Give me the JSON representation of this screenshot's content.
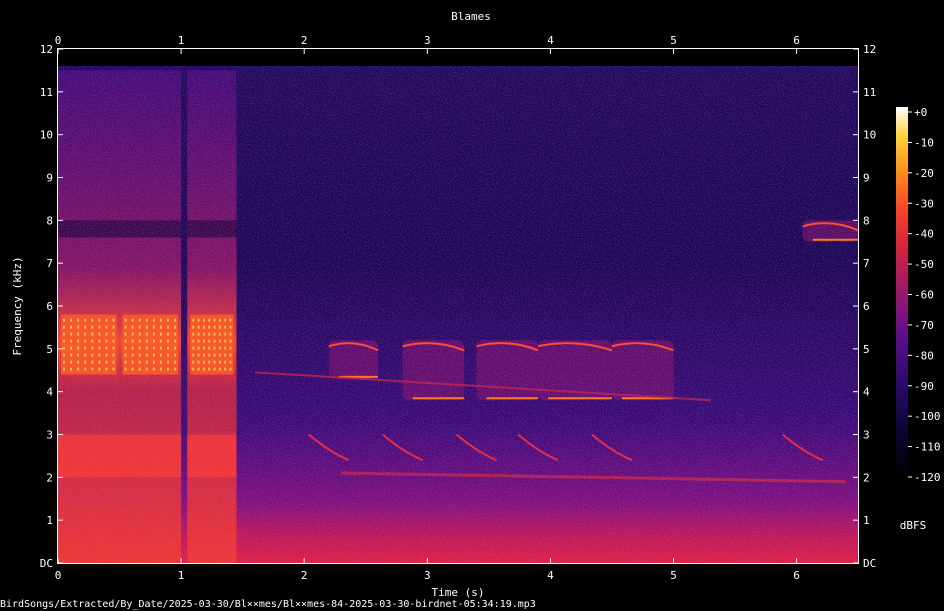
{
  "chart_data": {
    "type": "heatmap",
    "title": "Blames",
    "xlabel": "Time (s)",
    "ylabel": "Frequency (kHz)",
    "xlim": [
      0,
      6.5
    ],
    "ylim": [
      0,
      12
    ],
    "x_ticks": [
      "0",
      "1",
      "2",
      "3",
      "4",
      "5",
      "6"
    ],
    "y_ticks": [
      "DC",
      "1",
      "2",
      "3",
      "4",
      "5",
      "6",
      "7",
      "8",
      "9",
      "10",
      "11",
      "12"
    ],
    "colorbar": {
      "label": "dBFS",
      "range": [
        -120,
        0
      ],
      "ticks": [
        "+0",
        "-10",
        "-20",
        "-30",
        "-40",
        "-50",
        "-60",
        "-70",
        "-80",
        "-90",
        "-100",
        "-110",
        "-120"
      ]
    },
    "features": [
      {
        "kind": "broadband-burst",
        "t": [
          0.0,
          0.5
        ],
        "f": [
          0,
          11.5
        ],
        "level": "high"
      },
      {
        "kind": "broadband-burst",
        "t": [
          0.5,
          1.0
        ],
        "f": [
          0,
          11.5
        ],
        "level": "high"
      },
      {
        "kind": "broadband-burst",
        "t": [
          1.05,
          1.45
        ],
        "f": [
          0,
          11.5
        ],
        "level": "high"
      },
      {
        "kind": "tonal-note",
        "t": [
          2.2,
          2.6
        ],
        "f": [
          4.3,
          5.2
        ]
      },
      {
        "kind": "tonal-note",
        "t": [
          2.8,
          3.3
        ],
        "f": [
          3.8,
          5.2
        ]
      },
      {
        "kind": "tonal-note",
        "t": [
          3.4,
          3.9
        ],
        "f": [
          3.8,
          5.2
        ]
      },
      {
        "kind": "tonal-note",
        "t": [
          3.9,
          4.5
        ],
        "f": [
          3.8,
          5.2
        ]
      },
      {
        "kind": "tonal-note",
        "t": [
          4.5,
          5.0
        ],
        "f": [
          3.8,
          5.2
        ]
      },
      {
        "kind": "tonal-note",
        "t": [
          6.05,
          6.5
        ],
        "f": [
          7.5,
          8.0
        ]
      }
    ]
  },
  "footer": {
    "path": "BirdSongs/Extracted/By_Date/2025-03-30/Bl××mes/Bl××mes-84-2025-03-30-birdnet-05:34:19.mp3"
  },
  "colors": {
    "background": "#000000",
    "text": "#ffffff",
    "colormap": [
      "#000000",
      "#0b0530",
      "#2a0a6a",
      "#5a0e8a",
      "#9a1a6c",
      "#d4233c",
      "#f5432a",
      "#ff8a1c",
      "#ffd23a",
      "#ffffff"
    ]
  }
}
